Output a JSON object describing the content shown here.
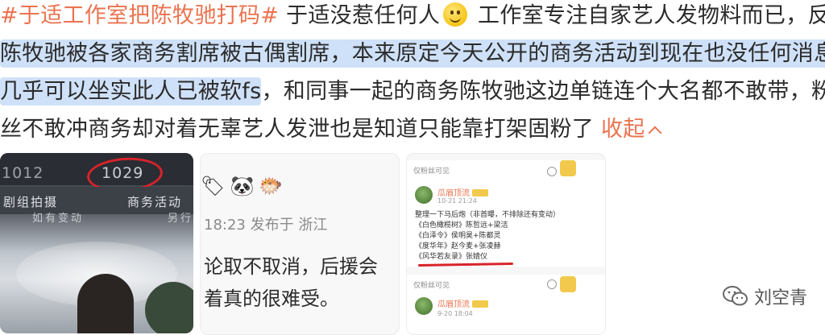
{
  "post": {
    "line1_tag": "#于适工作室把陈牧驰打码#",
    "line1_a": " 于适没惹任何人",
    "line1_emoji": "smiley-emoji",
    "line1_b": " 工作室专注自家艺人发物料而已，反倒",
    "line2": "陈牧驰被各家商务割席被古偶割席，本来原定今天公开的商务活动到现在也没任何消息",
    "line3_hl": "几乎可以坐实此人已被软fs",
    "line3_b": "，和同事一起的商务陈牧驰这边单链连个大名都不敢带，粉",
    "line4_a": "丝不敢冲商务却对着无辜艺人发泄也是知道只能靠打架固粉了",
    "collapse_label": "收起"
  },
  "images": {
    "img1": {
      "num_left": "1012",
      "num_right": "1029",
      "label_a": "剧组拍摄",
      "label_b": "商务活动",
      "sub_a": "如有变动",
      "sub_b": "另行"
    },
    "img2": {
      "meta": "18:23  发布于 浙江",
      "text1": "论取不取消，后援会",
      "text2": "着真的很难受。"
    },
    "img3": {
      "fans_only_1": "仅粉丝可见",
      "fans_only_2": "仅粉丝可见",
      "username_1": "瓜眉顶流",
      "username_2": "瓜眉顶流",
      "time_1": "10-21 21:24",
      "time_2": "9-20 18:04",
      "body_lines": [
        "整理一下马后炮（非首曝，不排除还有变动）",
        "《白色橄榄树》陈哲远+梁洁",
        "《白泽令》侯明昊+陈都灵",
        "《度华年》赵今麦+张凌赫",
        "《风华若友录》张婧仪"
      ]
    }
  },
  "watermark": {
    "text": "刘空青",
    "icon": "wechat-icon"
  },
  "colors": {
    "accent": "#eb7350",
    "highlight": "#cfe1f8",
    "red_mark": "#d8232a"
  }
}
